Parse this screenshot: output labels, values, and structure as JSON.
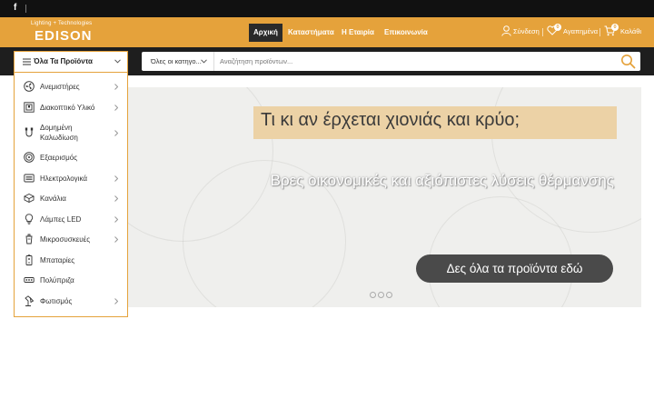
{
  "topbar": {
    "social_icon": "facebook-icon"
  },
  "brand": {
    "tagline": "Lighting + Technologies",
    "name": "EDISON"
  },
  "nav": {
    "items": [
      {
        "label": "Αρχική",
        "active": true
      },
      {
        "label": "Καταστήματα",
        "active": false
      },
      {
        "label": "Η Εταιρία",
        "active": false
      },
      {
        "label": "Επικοινωνία",
        "active": false
      }
    ]
  },
  "account": {
    "login_label": "Σύνδεση",
    "wishlist_label": "Αγαπημένα",
    "wishlist_count": "0",
    "cart_label": "Καλάθι",
    "cart_count": "0"
  },
  "categories_button": {
    "label": "Όλα Τα Προϊόντα"
  },
  "search": {
    "category_select": "Όλες οι κατηγο...",
    "placeholder": "Αναζήτηση προϊόντων..."
  },
  "categories": [
    {
      "label": "Ανεμιστήρες",
      "icon": "fan-icon",
      "has_submenu": true
    },
    {
      "label": "Διακοπτικό Υλικό",
      "icon": "switch-icon",
      "has_submenu": true
    },
    {
      "label": "Δομημένη Καλωδίωση",
      "icon": "cable-icon",
      "has_submenu": true
    },
    {
      "label": "Εξαερισμός",
      "icon": "ventilation-icon",
      "has_submenu": false
    },
    {
      "label": "Ηλεκτρολογικά",
      "icon": "electrical-icon",
      "has_submenu": true
    },
    {
      "label": "Κανάλια",
      "icon": "channel-icon",
      "has_submenu": true
    },
    {
      "label": "Λάμπες LED",
      "icon": "bulb-icon",
      "has_submenu": true
    },
    {
      "label": "Μικροσυσκευές",
      "icon": "appliance-icon",
      "has_submenu": true
    },
    {
      "label": "Μπαταρίες",
      "icon": "battery-icon",
      "has_submenu": false
    },
    {
      "label": "Πολύπριζα",
      "icon": "power-strip-icon",
      "has_submenu": false
    },
    {
      "label": "Φωτισμός",
      "icon": "lamp-icon",
      "has_submenu": true
    }
  ],
  "banner": {
    "headline": "Τι κι αν έρχεται χιονιάς και κρύο;",
    "subline": "Βρες οικονομικές και αξιόπιστες λύσεις θέρμανσης",
    "cta": "Δες όλα τα προϊόντα εδώ",
    "slide_count": 3
  },
  "colors": {
    "accent": "#e5a23b",
    "dark": "#1e1e1e",
    "topbar": "#111111"
  }
}
